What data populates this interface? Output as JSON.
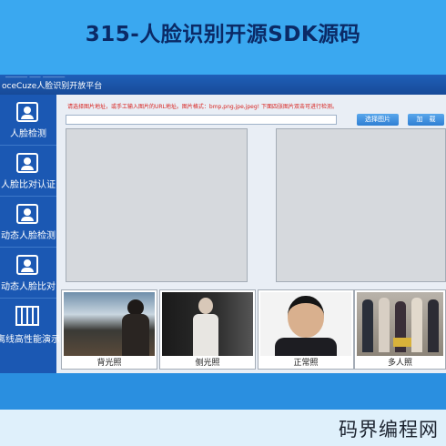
{
  "banner": {
    "title": "315-人脸识别开源SDK源码"
  },
  "window": {
    "title": "oceCuze人脸识别开放平台",
    "title_faint": "______  ___ ______"
  },
  "sidebar": {
    "items": [
      {
        "label": "人脸检测",
        "icon": "face-detect-icon"
      },
      {
        "label": "人脸比对认证",
        "icon": "face-compare-icon"
      },
      {
        "label": "动态人脸检测",
        "icon": "dynamic-face-icon"
      },
      {
        "label": "动态人脸比对",
        "icon": "dynamic-compare-icon"
      },
      {
        "label": "离线高性能演示",
        "icon": "film-icon"
      }
    ]
  },
  "main": {
    "hint": "请选择图片地址，或手工输入图片的URL地址。图片格式：bmp,png,jpe,jpeg! 下面四张图片双击可进行检测。",
    "path_value": "",
    "select_button": "选择图片",
    "load_button": "加　载"
  },
  "thumbnails": [
    {
      "caption": "背光照"
    },
    {
      "caption": "侧光照"
    },
    {
      "caption": "正常照"
    },
    {
      "caption": "多人照"
    }
  ],
  "footer": {
    "watermark": "码界编程网"
  }
}
